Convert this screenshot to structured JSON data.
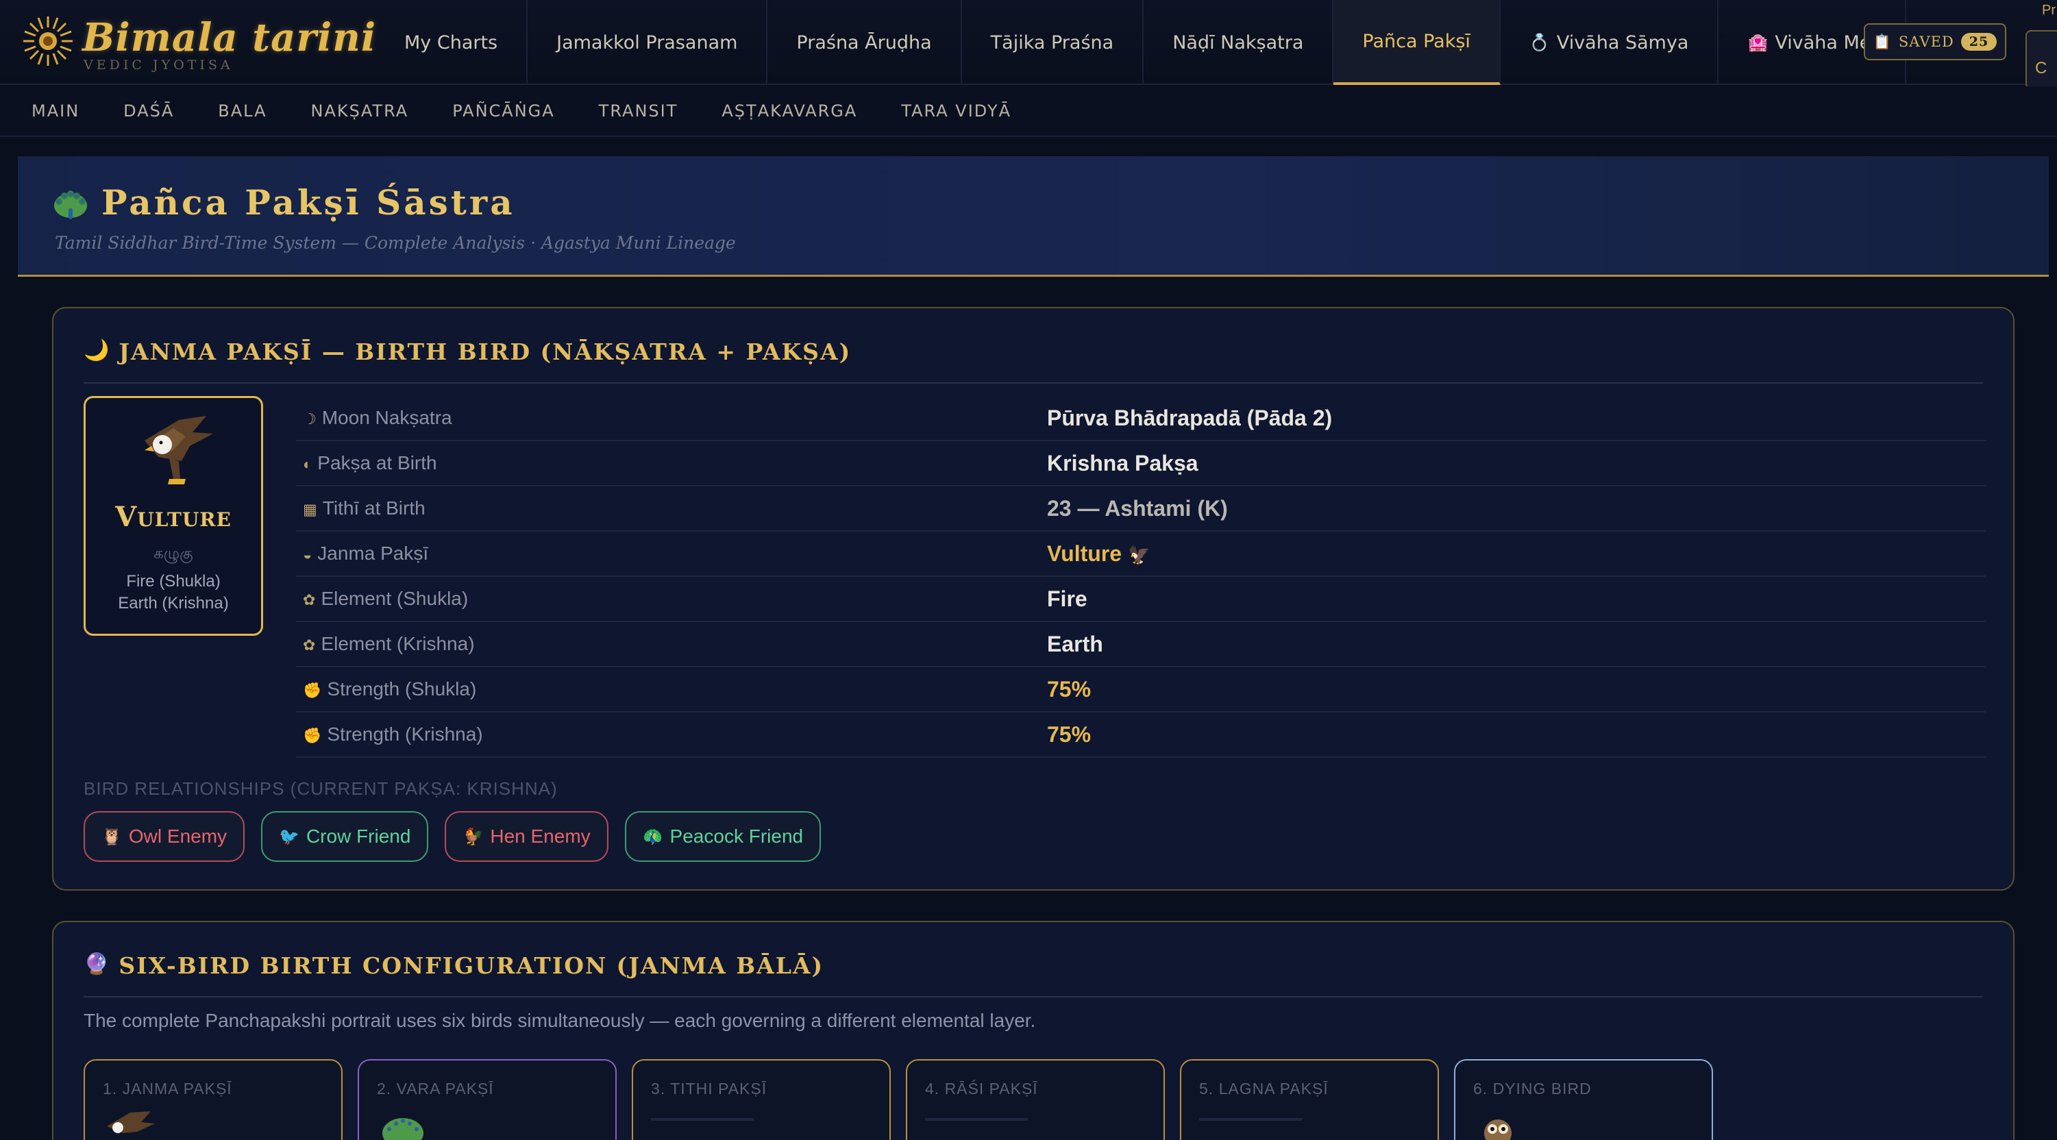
{
  "app": {
    "brand": "Bimala tarini",
    "tagline": "Vedic Jyotisa"
  },
  "nav": {
    "items": [
      {
        "label": "My Charts"
      },
      {
        "label": "Jamakkol Prasanam"
      },
      {
        "label": "Praśna Āruḍha"
      },
      {
        "label": "Tājika Praśna"
      },
      {
        "label": "Nāḍī Nakṣatra"
      },
      {
        "label": "Pañca Pakṣī",
        "active": true
      },
      {
        "label": "Vivāha Sāmya"
      },
      {
        "label": "Vivāha Mel"
      }
    ],
    "saved_label": "Saved",
    "saved_count": "25",
    "corner_top": "Pr",
    "corner_panel": "C"
  },
  "subnav": {
    "items": [
      "Main",
      "Daśā",
      "Bala",
      "Nakṣatra",
      "Pañcāṅga",
      "Transit",
      "Aṣṭakavarga",
      "Tara Vidyā"
    ]
  },
  "hero": {
    "title": "Pañca Pakṣī Śāstra",
    "subtitle": "Tamil Siddhar Bird-Time System — Complete Analysis · Agastya Muni Lineage"
  },
  "janma": {
    "title": "Janma Pakṣī — Birth Bird (Nākṣatra + Pakṣa)",
    "bird": {
      "name": "Vulture",
      "tamil": "கழுகு",
      "element_shukla": "Fire (Shukla)",
      "element_krishna": "Earth (Krishna)"
    },
    "rows": [
      {
        "label": "Moon Nakṣatra",
        "icon": "☽",
        "value": "Pūrva Bhādrapadā (Pāda 2)",
        "tone": "white"
      },
      {
        "label": "Pakṣa at Birth",
        "icon": "◐",
        "value": "Krishna Pakṣa",
        "tone": "white"
      },
      {
        "label": "Tithī at Birth",
        "icon": "▦",
        "value": "23 — Ashtami (K)",
        "tone": "grey"
      },
      {
        "label": "Janma Pakṣī",
        "icon": "◒",
        "value": "Vulture",
        "tone": "gold"
      },
      {
        "label": "Element (Shukla)",
        "icon": "✿",
        "value": "Fire",
        "tone": "white"
      },
      {
        "label": "Element (Krishna)",
        "icon": "✿",
        "value": "Earth",
        "tone": "white"
      },
      {
        "label": "Strength (Shukla)",
        "icon": "✊",
        "value": "75%",
        "tone": "gold"
      },
      {
        "label": "Strength (Krishna)",
        "icon": "✊",
        "value": "75%",
        "tone": "gold"
      }
    ],
    "relationships_heading": "Bird Relationships (Current Pakṣa: Krishna)",
    "relationships": [
      {
        "bird": "Owl",
        "relation": "Enemy",
        "type": "enemy",
        "icon": "owl-icon"
      },
      {
        "bird": "Crow",
        "relation": "Friend",
        "type": "friend",
        "icon": "crow-icon"
      },
      {
        "bird": "Hen",
        "relation": "Enemy",
        "type": "enemy",
        "icon": "hen-icon"
      },
      {
        "bird": "Peacock",
        "relation": "Friend",
        "type": "friend",
        "icon": "peacock-icon"
      }
    ]
  },
  "six_bird": {
    "title": "Six-Bird Birth Configuration (Janma Bālā)",
    "intro": "The complete Panchapakshi portrait uses six birds simultaneously — each governing a different elemental layer.",
    "cards": [
      {
        "label": "1. Janma Pakṣī",
        "icon": "vulture-icon"
      },
      {
        "label": "2. Vara Pakṣī",
        "icon": "peacock-icon"
      },
      {
        "label": "3. Tithi Pakṣī",
        "icon": ""
      },
      {
        "label": "4. Rāśi Pakṣī",
        "icon": ""
      },
      {
        "label": "5. Lagna Pakṣī",
        "icon": ""
      },
      {
        "label": "6. Dying Bird",
        "icon": "owl-icon"
      }
    ]
  },
  "colors": {
    "accent_gold": "#e2b84c",
    "enemy": "#e8656a",
    "friend": "#5fd39a",
    "background": "#0a0f1e"
  }
}
